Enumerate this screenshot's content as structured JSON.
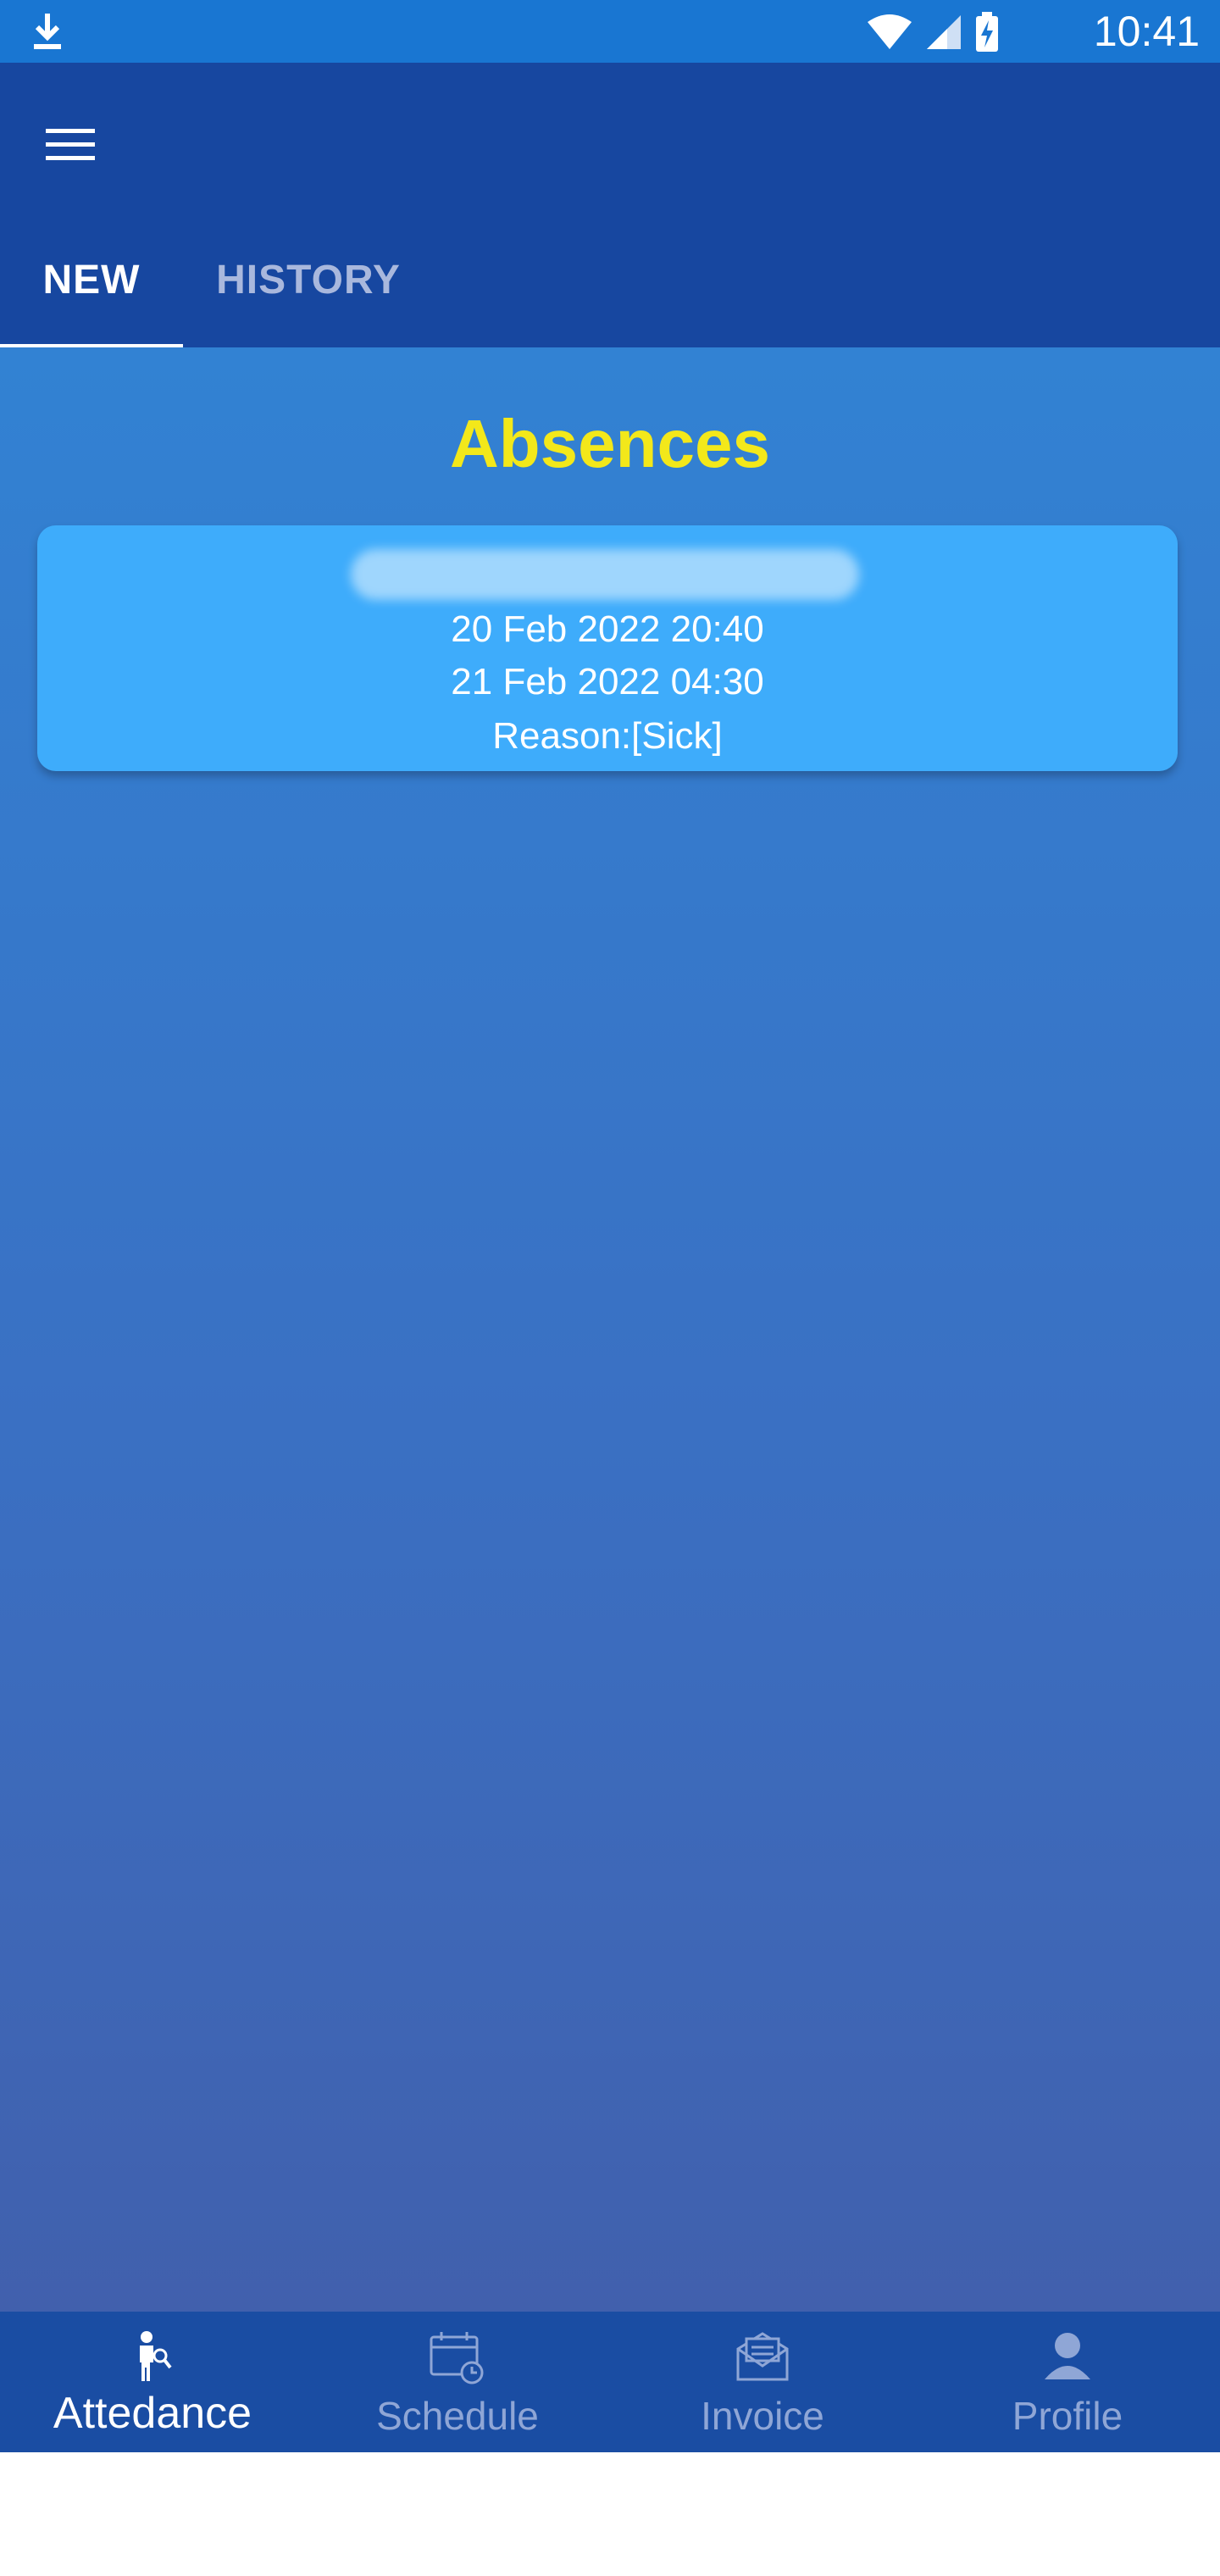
{
  "status_bar": {
    "time": "10:41"
  },
  "tabs": [
    {
      "label": "NEW"
    },
    {
      "label": "HISTORY"
    }
  ],
  "main": {
    "title": "Absences",
    "absences": [
      {
        "start": "20 Feb 2022 20:40",
        "end": "21 Feb 2022 04:30",
        "reason": "Reason:[Sick]"
      }
    ]
  },
  "bottom_nav": {
    "items": [
      {
        "label": "Attedance",
        "icon": "attendance-icon"
      },
      {
        "label": "Schedule",
        "icon": "calendar-icon"
      },
      {
        "label": "Invoice",
        "icon": "invoice-icon"
      },
      {
        "label": "Profile",
        "icon": "profile-icon"
      }
    ]
  },
  "colors": {
    "status_bar": "#1976d2",
    "app_bar": "#1747a0",
    "title": "#f3e81a",
    "card": "#3eacfb",
    "bottom_nav": "#1a4da3"
  }
}
